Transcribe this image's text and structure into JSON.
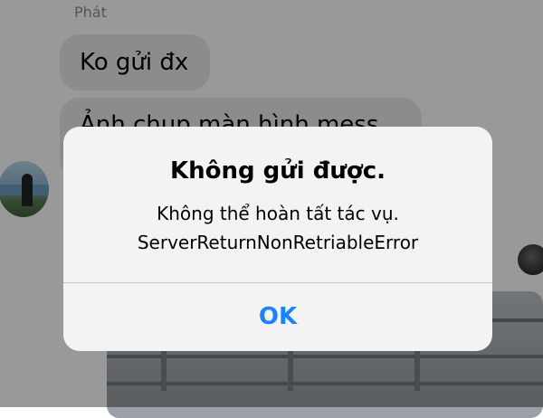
{
  "chat": {
    "sender_name": "Phát",
    "messages": [
      {
        "text": "Ko gửi đx"
      },
      {
        "text": "Ảnh chụp màn hình mess"
      }
    ]
  },
  "alert": {
    "title": "Không gửi được.",
    "message_line1": "Không thể hoàn tất tác vụ.",
    "message_line2": "ServerReturnNonRetriableError",
    "button_label": "OK",
    "button_color": "#1a82fb"
  },
  "icons": {
    "sender_avatar": "avatar",
    "user_avatar": "avatar"
  }
}
